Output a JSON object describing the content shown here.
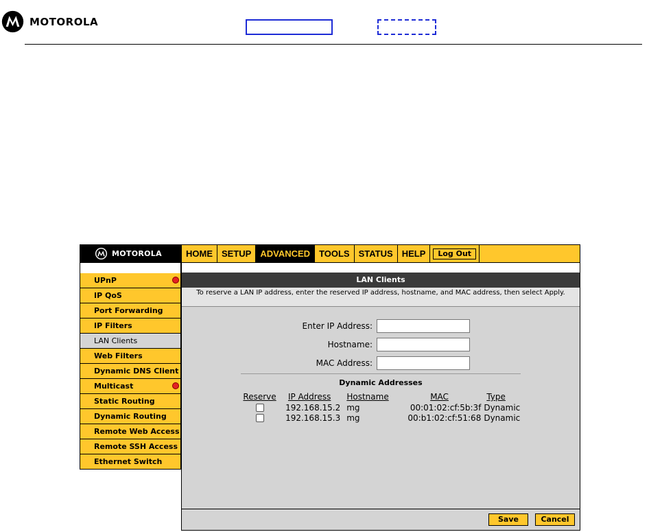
{
  "doc": {
    "brand": "MOTOROLA"
  },
  "ui": {
    "brand": "MOTOROLA",
    "nav": [
      "HOME",
      "SETUP",
      "ADVANCED",
      "TOOLS",
      "STATUS",
      "HELP"
    ],
    "nav_active": "ADVANCED",
    "logout_label": "Log Out",
    "sidebar": [
      {
        "label": "UPnP",
        "alert": true
      },
      {
        "label": "IP QoS",
        "alert": false
      },
      {
        "label": "Port Forwarding",
        "alert": false
      },
      {
        "label": "IP Filters",
        "alert": false
      },
      {
        "label": "LAN Clients",
        "alert": false,
        "active": true
      },
      {
        "label": "Web Filters",
        "alert": false
      },
      {
        "label": "Dynamic DNS Client",
        "alert": false
      },
      {
        "label": "Multicast",
        "alert": true
      },
      {
        "label": "Static Routing",
        "alert": false
      },
      {
        "label": "Dynamic Routing",
        "alert": false
      },
      {
        "label": "Remote Web Access",
        "alert": false
      },
      {
        "label": "Remote SSH Access",
        "alert": false
      },
      {
        "label": "Ethernet Switch",
        "alert": false
      }
    ],
    "content": {
      "title": "LAN Clients",
      "description": "To reserve a LAN IP address, enter the reserved IP address, hostname, and MAC address, then select Apply.",
      "fields": {
        "ip_label": "Enter IP Address:",
        "ip_value": "",
        "hostname_label": "Hostname:",
        "hostname_value": "",
        "mac_label": "MAC Address:",
        "mac_value": ""
      },
      "dynamic_title": "Dynamic Addresses",
      "table": {
        "headers": [
          "Reserve",
          "IP Address",
          "Hostname",
          "MAC",
          "Type"
        ],
        "rows": [
          {
            "ip": "192.168.15.2",
            "hostname": "mg",
            "mac": "00:01:02:cf:5b:3f",
            "type": "Dynamic"
          },
          {
            "ip": "192.168.15.3",
            "hostname": "mg",
            "mac": "00:b1:02:cf:51:68",
            "type": "Dynamic"
          }
        ]
      },
      "save_label": "Save",
      "cancel_label": "Cancel"
    }
  },
  "colors": {
    "accent": "#ffc72c",
    "dark": "#000000",
    "panel": "#d4d4d4",
    "alert": "#e32222",
    "annotation": "#1d2bd6"
  }
}
